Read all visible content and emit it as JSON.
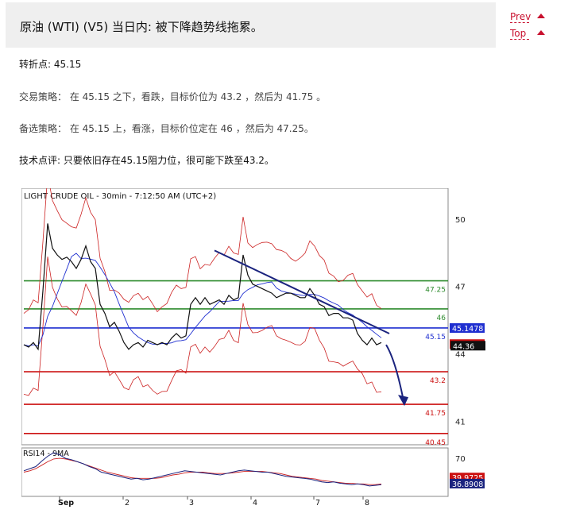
{
  "header": {
    "title": "原油 (WTI) (V5) 当日内: 被下降趋势线拖累。",
    "prev_label": "Prev",
    "top_label": "Top"
  },
  "analysis": {
    "turn_point": "转折点: 45.15",
    "trading_strategy": "交易策略： 在 45.15 之下，看跌，目标价位为 43.2 ，然后为 41.75 。",
    "alternative_strategy": "备选策略： 在 45.15 上，看涨，目标价位定在 46 ，然后为 47.25。",
    "technical_comment": "技术点评: 只要依旧存在45.15阻力位，很可能下跌至43.2。"
  },
  "chart_data": {
    "type": "line",
    "title": "LIGHT CRUDE OIL - 30min - 7:12:50 AM (UTC+2)",
    "x_ticks": [
      "Sep",
      "2",
      "3",
      "4",
      "7",
      "8"
    ],
    "price_axis": {
      "ticks": [
        50,
        47,
        44,
        41
      ],
      "ylim": [
        39.95,
        51.3
      ]
    },
    "levels": [
      {
        "value": 47.25,
        "label": "47.25",
        "color": "#2e8b2e"
      },
      {
        "value": 46,
        "label": "46",
        "color": "#2e8b2e"
      },
      {
        "value": 45.15,
        "label": "45.15",
        "color": "#1f2fd0"
      },
      {
        "value": 43.2,
        "label": "43.2",
        "color": "#cc1111"
      },
      {
        "value": 41.75,
        "label": "41.75",
        "color": "#cc1111"
      },
      {
        "value": 40.45,
        "label": "40.45",
        "color": "#cc1111"
      }
    ],
    "price_tags": [
      {
        "value": 45.1478,
        "label": "45.1478",
        "bg": "#1f2fd0"
      },
      {
        "value": 44.5386,
        "label": "44.5386",
        "bg": "#cc1111"
      },
      {
        "value": 44.36,
        "label": "44.36",
        "bg": "#111111"
      }
    ],
    "price_series": [
      44.4,
      44.3,
      44.5,
      44.2,
      46.8,
      49.8,
      48.7,
      48.4,
      48.2,
      48.3,
      48.1,
      47.8,
      48.2,
      48.8,
      48.1,
      47.8,
      46.2,
      45.8,
      45.2,
      45.4,
      45.0,
      44.5,
      44.2,
      44.4,
      44.5,
      44.3,
      44.6,
      44.5,
      44.4,
      44.5,
      44.4,
      44.7,
      44.9,
      44.7,
      44.8,
      46.2,
      46.5,
      46.2,
      46.5,
      46.2,
      46.3,
      46.4,
      46.2,
      46.6,
      46.4,
      46.5,
      48.4,
      47.5,
      47.1,
      47.0,
      46.9,
      46.8,
      46.7,
      46.5,
      46.6,
      46.7,
      46.7,
      46.6,
      46.5,
      46.5,
      46.9,
      46.6,
      46.2,
      46.1,
      45.7,
      45.8,
      45.8,
      45.6,
      45.6,
      45.5,
      44.9,
      44.6,
      44.4,
      44.7,
      44.4,
      44.5
    ],
    "trendline": {
      "from": 48.6,
      "to": 44.9
    },
    "projection": {
      "from": 44.4,
      "to": 41.75
    },
    "rsi": {
      "label": "RSI14 - 9MA",
      "ticks": [
        70
      ],
      "ylim": [
        15,
        85
      ],
      "tags": [
        {
          "value": 39.9725,
          "label": "39.9725",
          "bg": "#cc1111"
        },
        {
          "value": 36.8908,
          "label": "36.8908",
          "bg": "#1a237e"
        }
      ],
      "values": [
        52,
        55,
        58,
        66,
        73,
        78,
        75,
        70,
        68,
        65,
        62,
        58,
        55,
        50,
        48,
        46,
        44,
        42,
        40,
        41,
        39,
        40,
        42,
        44,
        46,
        48,
        50,
        52,
        51,
        50,
        49,
        48,
        47,
        46,
        48,
        50,
        52,
        53,
        52,
        51,
        50,
        50,
        48,
        46,
        44,
        43,
        42,
        41,
        40,
        38,
        36,
        35,
        36,
        34,
        33,
        32,
        33,
        32,
        30,
        31,
        32
      ],
      "ma": [
        50,
        52,
        55,
        60,
        65,
        69,
        70,
        69,
        67,
        65,
        62,
        59,
        56,
        53,
        50,
        48,
        46,
        44,
        42,
        41,
        41,
        41,
        41,
        42,
        44,
        46,
        47,
        49,
        50,
        50,
        50,
        49,
        48,
        48,
        48,
        49,
        50,
        51,
        51,
        51,
        51,
        50,
        49,
        48,
        46,
        44,
        43,
        42,
        41,
        40,
        38,
        37,
        36,
        35,
        34,
        34,
        33,
        33,
        32,
        32,
        33
      ]
    }
  }
}
